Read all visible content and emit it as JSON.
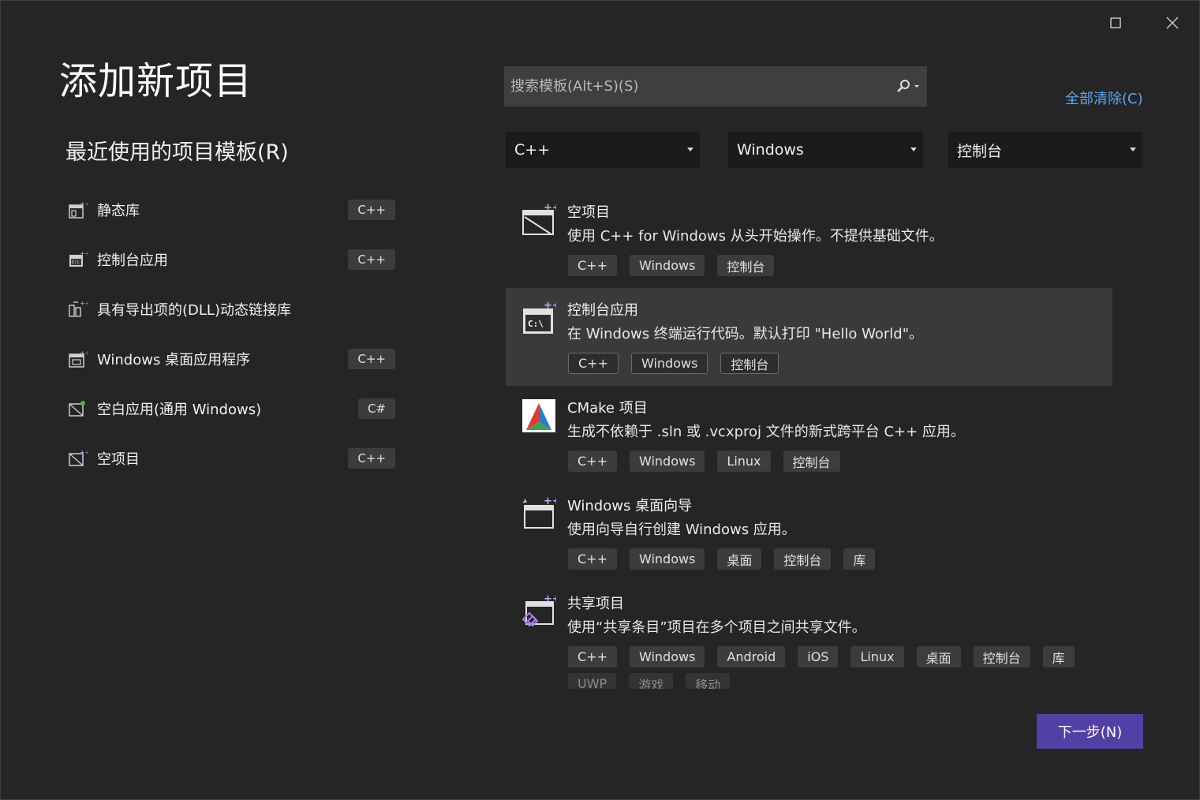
{
  "dialog": {
    "title": "添加新项目",
    "recent_heading": "最近使用的项目模板(R)",
    "next_button": "下一步(N)",
    "clear_all": "全部清除(C)"
  },
  "recent": [
    {
      "label": "静态库",
      "lang": "C++",
      "icon": "static-lib-icon"
    },
    {
      "label": "控制台应用",
      "lang": "C++",
      "icon": "console-app-icon"
    },
    {
      "label": "具有导出项的(DLL)动态链接库",
      "lang": "",
      "icon": "dll-icon"
    },
    {
      "label": "Windows 桌面应用程序",
      "lang": "C++",
      "icon": "desktop-app-icon"
    },
    {
      "label": "空白应用(通用 Windows)",
      "lang": "C#",
      "icon": "uwp-app-icon"
    },
    {
      "label": "空项目",
      "lang": "C++",
      "icon": "empty-project-icon"
    }
  ],
  "search": {
    "placeholder": "搜索模板(Alt+S)(S)",
    "value": ""
  },
  "filters": {
    "language": "C++",
    "platform": "Windows",
    "project_type": "控制台"
  },
  "templates": [
    {
      "name": "空项目",
      "desc": "使用 C++ for Windows 从头开始操作。不提供基础文件。",
      "tags": [
        "C++",
        "Windows",
        "控制台"
      ],
      "selected": false
    },
    {
      "name": "控制台应用",
      "desc": "在 Windows 终端运行代码。默认打印 \"Hello World\"。",
      "tags": [
        "C++",
        "Windows",
        "控制台"
      ],
      "selected": true
    },
    {
      "name": "CMake 项目",
      "desc": "生成不依赖于 .sln 或 .vcxproj 文件的新式跨平台 C++ 应用。",
      "tags": [
        "C++",
        "Windows",
        "Linux",
        "控制台"
      ],
      "selected": false
    },
    {
      "name": "Windows 桌面向导",
      "desc": "使用向导自行创建 Windows 应用。",
      "tags": [
        "C++",
        "Windows",
        "桌面",
        "控制台",
        "库"
      ],
      "selected": false
    },
    {
      "name": "共享项目",
      "desc": "使用“共享条目”项目在多个项目之间共享文件。",
      "tags": [
        "C++",
        "Windows",
        "Android",
        "iOS",
        "Linux",
        "桌面",
        "控制台",
        "库"
      ],
      "tags_more": [
        "UWP",
        "游戏",
        "移动"
      ],
      "selected": false
    }
  ],
  "colors": {
    "accent": "#5340a6",
    "link": "#5ea4ef",
    "background": "#252526"
  }
}
